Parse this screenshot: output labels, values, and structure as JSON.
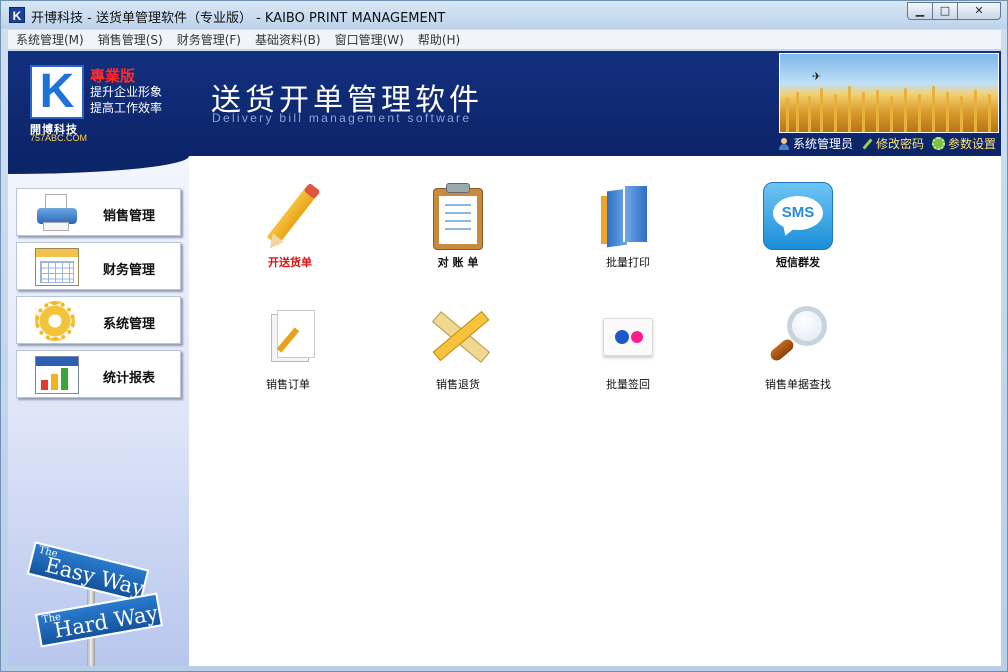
{
  "window": {
    "title": "开博科技 - 送货单管理软件（专业版） - KAIBO PRINT MANAGEMENT",
    "controls": {
      "minimize": "▁",
      "maximize": "□",
      "close": "✕"
    }
  },
  "menu": {
    "items": [
      {
        "label": "系统管理(M)"
      },
      {
        "label": "销售管理(S)"
      },
      {
        "label": "财务管理(F)"
      },
      {
        "label": "基础资料(B)"
      },
      {
        "label": "窗口管理(W)"
      },
      {
        "label": "帮助(H)"
      }
    ]
  },
  "header": {
    "logo_letter": "K",
    "logo_badge": "專業版",
    "slogan_line1": "提升企业形象",
    "slogan_line2": "提高工作效率",
    "company": "開博科技",
    "site": "757ABC.COM",
    "app_title": "送货开单管理软件",
    "app_subtitle": "Delivery bill management software",
    "links": {
      "user": "系统管理员",
      "change_password": "修改密码",
      "settings": "参数设置"
    }
  },
  "sidebar": {
    "items": [
      {
        "label": "销售管理",
        "icon": "printer-icon"
      },
      {
        "label": "财务管理",
        "icon": "calendar-icon"
      },
      {
        "label": "系统管理",
        "icon": "gear-icon"
      },
      {
        "label": "统计报表",
        "icon": "bar-chart-icon"
      }
    ],
    "signpost": {
      "sign1_small": "The",
      "sign1_big": "Easy Way",
      "sign2_small": "The",
      "sign2_big": "Hard Way"
    }
  },
  "main": {
    "tiles": [
      {
        "label": "开送货单",
        "icon": "pencil-icon"
      },
      {
        "label": "对 账 单",
        "icon": "clipboard-icon"
      },
      {
        "label": "批量打印",
        "icon": "books-icon"
      },
      {
        "label": "短信群发",
        "icon": "sms-icon",
        "icon_text": "SMS"
      },
      {
        "label": "销售订单",
        "icon": "document-icon"
      },
      {
        "label": "销售退货",
        "icon": "ruler-pencil-icon"
      },
      {
        "label": "批量签回",
        "icon": "dots-icon"
      },
      {
        "label": "销售单据查找",
        "icon": "magnifier-icon"
      }
    ]
  },
  "colors": {
    "header_bg": "#0f2a78",
    "accent_red": "#d11111",
    "link_yellow": "#ffe36b"
  }
}
